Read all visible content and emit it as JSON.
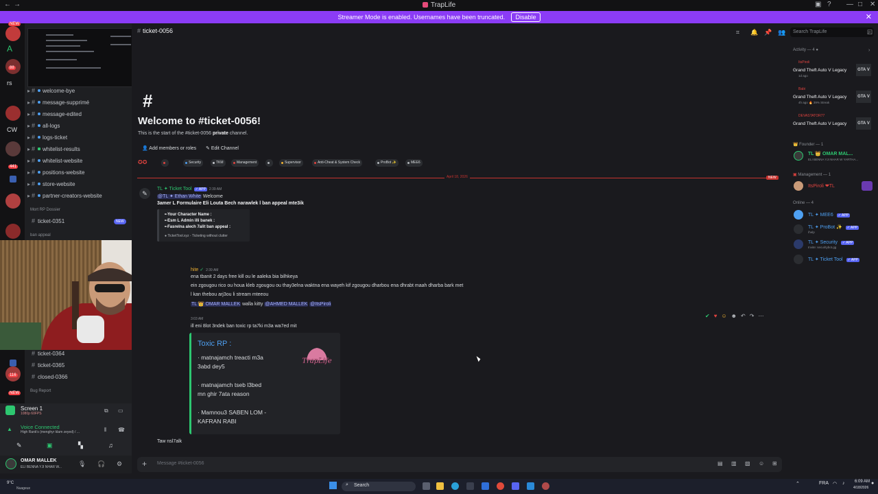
{
  "window": {
    "title": "TrapLife"
  },
  "banner": {
    "message": "Streamer Mode is enabled. Usernames have been truncated.",
    "disable_label": "Disable"
  },
  "guild_rail": {
    "items": [
      {
        "text": "A"
      },
      {
        "text": "rs"
      },
      {
        "text": "CW"
      }
    ],
    "badges": [
      "NEW",
      "88",
      "441",
      "116",
      "NEW"
    ]
  },
  "channels": {
    "items": [
      "welcome-bye",
      "message-supprimé",
      "message-edited",
      "all-logs",
      "logs-ticket",
      "whitelist-results",
      "whitelist-website",
      "positions-website",
      "store-website",
      "partner-creators-website"
    ],
    "category_mort": "Mort RP Dossier",
    "ticket_0351": "ticket-0351",
    "new_badge": "NEW",
    "category_ban": "ban appeal",
    "lower": [
      "ticket-0364",
      "ticket-0365",
      "closed-0366"
    ],
    "category_bug": "Bug Report"
  },
  "voice": {
    "screen_label": "Screen 1",
    "screen_sub": "1080p 60FPS",
    "connected_label": "Voice Connected",
    "connected_sub": "High Rank's (menghyr klam zeyed) / ..."
  },
  "user": {
    "name": "OMAR MALLEK",
    "status": "ELI BENNA YJI NHAR W..."
  },
  "header": {
    "channel_name": "ticket-0056",
    "search_placeholder": "Search TrapLife"
  },
  "welcome": {
    "title": "Welcome to #ticket-0056!",
    "subtitle_pre": "This is the start of the #ticket-0056 ",
    "subtitle_bold": "private",
    "subtitle_post": " channel.",
    "add_members": "Add members or roles",
    "edit_channel": "Edit Channel"
  },
  "roles": [
    {
      "name": "",
      "color": "#e0433f"
    },
    {
      "name": "Security",
      "color": "#4ea0f2"
    },
    {
      "name": "TKM",
      "color": "#c4c7cc"
    },
    {
      "name": "Management",
      "color": "#e0433f"
    },
    {
      "name": "",
      "color": "#b5b8bd"
    },
    {
      "name": "Supervisor",
      "color": "#f0b232"
    },
    {
      "name": "Anti-Cheat & System Check",
      "color": "#e0433f"
    },
    {
      "name": "ProBot ✨",
      "color": "#b5b8bd"
    },
    {
      "name": "MEE6",
      "color": "#b5b8bd"
    }
  ],
  "divider": {
    "date": "April 18, 2026",
    "new_label": "NEW"
  },
  "message1": {
    "author": "TL ✦ Ticket Tool",
    "app_tag": "✓ APP",
    "time": "2:39 AM",
    "mention": "@TL ✦ Ethan White",
    "greeting": "Welcome",
    "body": "3amer L Formulaire Eli Louta Bech narawlek l ban appeal mte3ik",
    "embed_lines": [
      "•-Your Character Name :",
      "•-Esm L Admin illi banek :",
      "•-Fasrelna alech 7alit ban appeal :"
    ],
    "embed_footer": "TicketTool.xyz - Ticketing without clutter"
  },
  "message2": {
    "author": "hite",
    "time": "2:39 AM",
    "lines": [
      "ena tbanit 2 days free kill ou le aaleka bia bilhkeya",
      "ein zgougou rico ou houa kleb zgougou ou thay3elna waktna ena wayeh kif zgougou dharbou ena dhrabt maah dharba bark met",
      "l kan thebou arj3ou li stream mteeou"
    ],
    "reply_prefix": "TL",
    "reply_user": "OMAR MALLEK",
    "reply_text": "walla kitty",
    "mention_a": "@AHMED MALLEK",
    "mention_b": "@ItsPiroli"
  },
  "message3": {
    "time": "3:03 AM",
    "line": "ill eni 8lot 3ndek ban toxic rp ta7ki m3a wa7ed mit",
    "embed_title": "Toxic RP :",
    "bullet1a": "·  matnajamch treacti m3a",
    "bullet1b": "3abd dey5",
    "bullet2a": "·  matnajamch tseb l3bed",
    "bullet2b": "mn ghir 7ata reason",
    "bullet3a": "· Mamnou3 SABEN LOM -",
    "bullet3b": "KAFRAN RABI",
    "logo_text": "TrapLife",
    "followup": "Taw nsl7alk"
  },
  "composer": {
    "placeholder": "Message #ticket-0056"
  },
  "members": {
    "activity_header": "Activity — 4",
    "activities": [
      {
        "user": "ItsPiroli",
        "game": "Grand Theft Auto V Legacy",
        "meta": "1d ago"
      },
      {
        "user": "Babi",
        "game": "Grand Theft Auto V Legacy",
        "meta": "4h ago  🔥 39% Streak"
      },
      {
        "user": "DEVASTATOR77",
        "game": "Grand Theft Auto V Legacy",
        "meta": ""
      }
    ],
    "gta_label": "GTA V",
    "founder_header": "Founder — 1",
    "founder_name": "TL 👑 OMAR MAL...",
    "founder_sub": "ELI BENNA YJI NHAR W YARTHA...",
    "management_header": "Management — 1",
    "management_name": "ItsPiroli ❤TL",
    "online_header": "Online — 4",
    "online": [
      {
        "name": "TL ✦ MEE6",
        "tag": "✓ APP",
        "sub": ""
      },
      {
        "name": "TL ✦ ProBot ✨",
        "tag": "✓ APP",
        "sub": "/help"
      },
      {
        "name": "TL ✦ Security",
        "tag": "✓ APP",
        "sub": "Invite: securitybot.gg"
      },
      {
        "name": "TL ✦ Ticket Tool",
        "tag": "✓ APP",
        "sub": ""
      }
    ]
  },
  "taskbar": {
    "weather_temp": "9°C",
    "weather_desc": "Nuageux",
    "search": "Search",
    "lang": "FRA",
    "time": "6:09 AM",
    "date": "4/18/2026"
  }
}
